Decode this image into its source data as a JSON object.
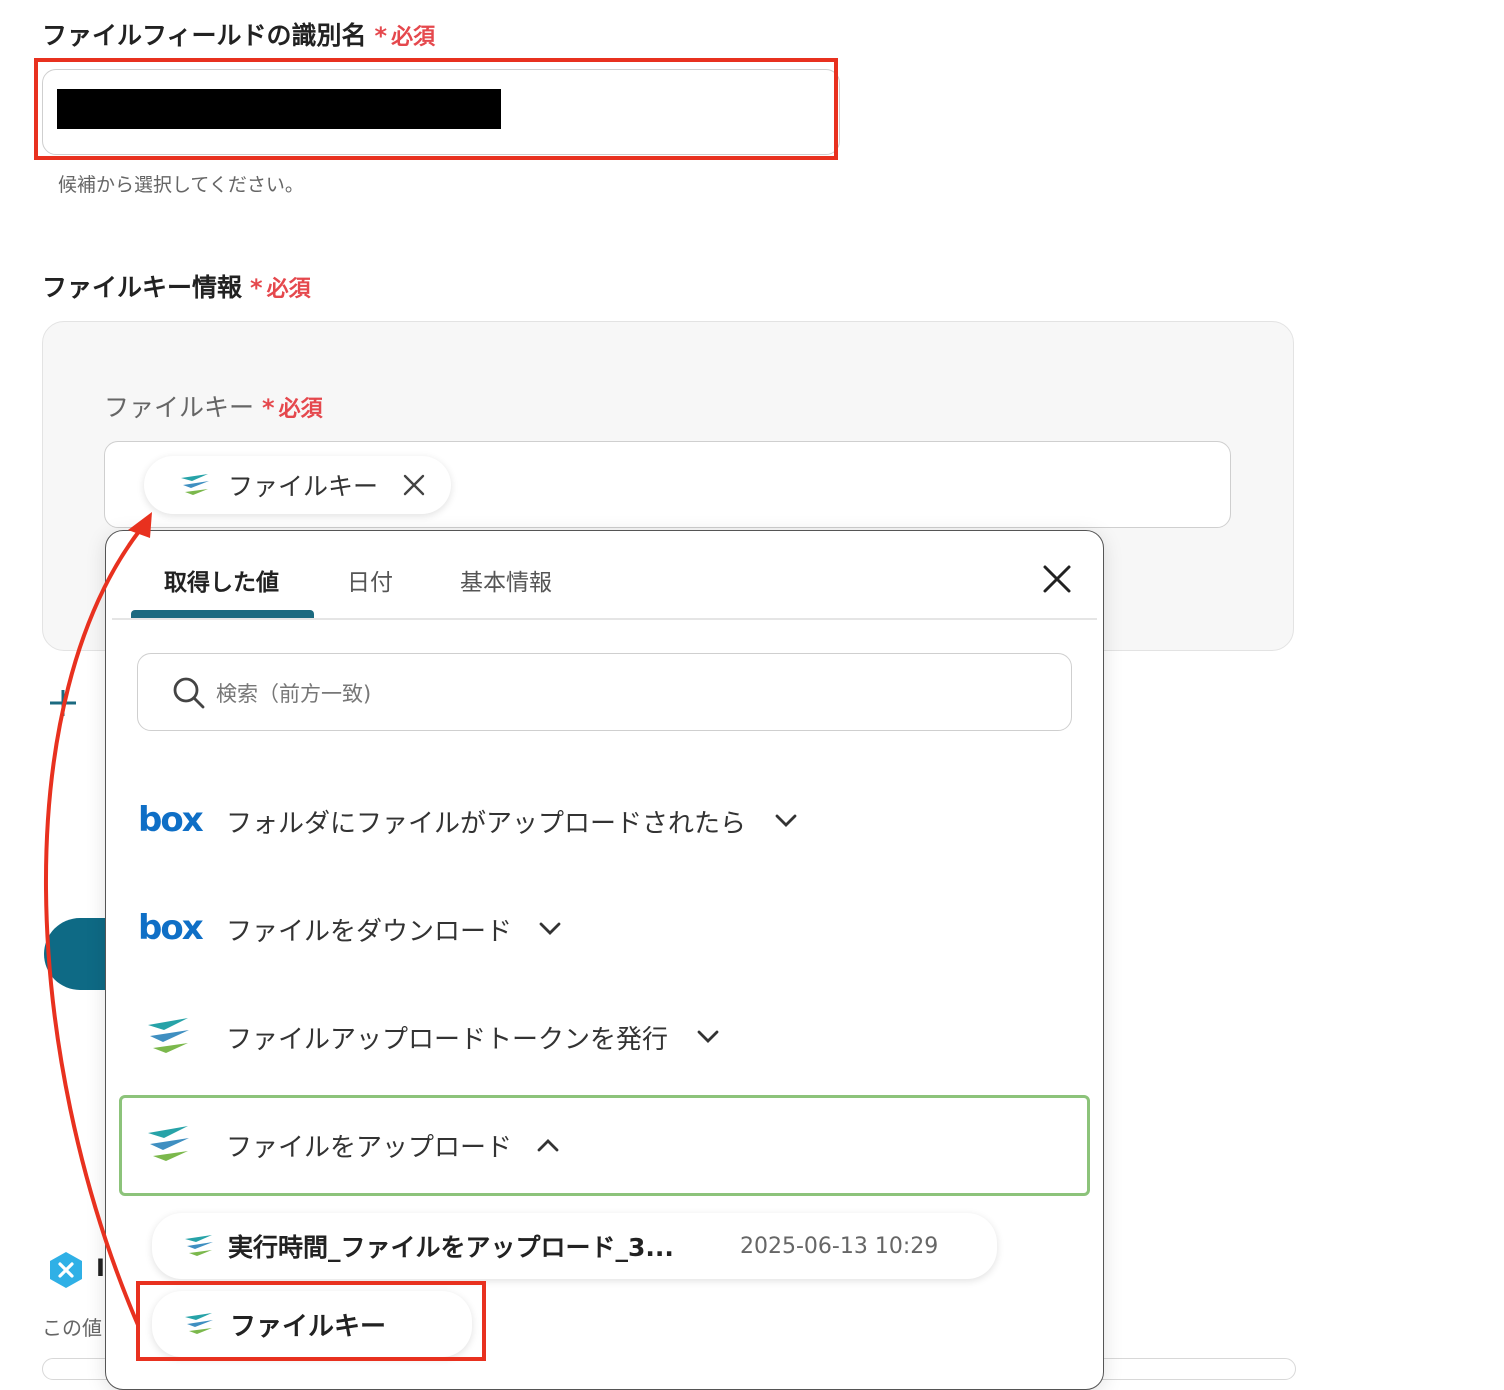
{
  "field1": {
    "label": "ファイルフィールドの識別名",
    "required": "必須",
    "hint": "候補から選択してください。"
  },
  "group": {
    "label": "ファイルキー情報",
    "required": "必須",
    "inner_label": "ファイルキー",
    "inner_required": "必須",
    "chip_label": "ファイルキー"
  },
  "panel": {
    "tabs": [
      {
        "label": "取得した値",
        "active": true
      },
      {
        "label": "日付",
        "active": false
      },
      {
        "label": "基本情報",
        "active": false
      }
    ],
    "search_placeholder": "検索（前方一致)",
    "sections": [
      {
        "icon": "box-logo",
        "logo_text": "box",
        "label": "フォルダにファイルがアップロードされたら",
        "expanded": false
      },
      {
        "icon": "box-logo",
        "logo_text": "box",
        "label": "ファイルをダウンロード",
        "expanded": false
      },
      {
        "icon": "yoom-icon",
        "label": "ファイルアップロードトークンを発行",
        "expanded": false
      },
      {
        "icon": "yoom-icon",
        "label": "ファイルをアップロード",
        "expanded": true
      }
    ],
    "items": [
      {
        "label": "実行時間_ファイルをアップロード_3...",
        "value": "2025-06-13 10:29"
      },
      {
        "label": "ファイルキー",
        "value": ""
      }
    ]
  },
  "background": {
    "partial_text": "この値",
    "partial_letter": "I"
  },
  "colors": {
    "required_red": "#e5484d",
    "annotation_red": "#e8311f",
    "tab_underline": "#1b6a80",
    "highlight_green": "#8cc37a",
    "box_blue": "#0f6fc6",
    "teal_button": "#0e6a85"
  }
}
